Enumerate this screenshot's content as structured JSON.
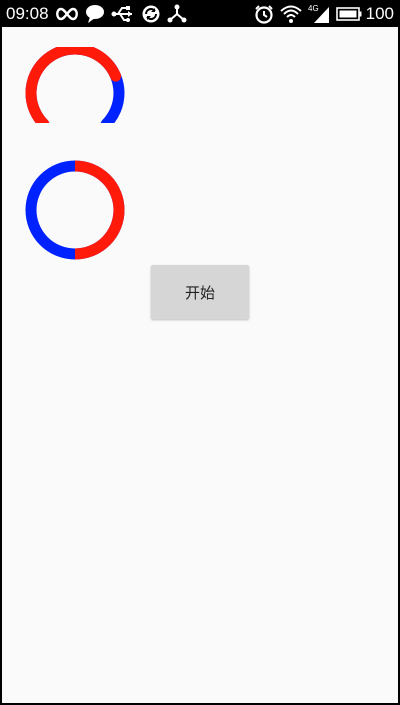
{
  "status_bar": {
    "time": "09:08",
    "battery_level": "100",
    "network_label": "4G",
    "left_icons": [
      "infinity-icon",
      "chat-bubble-icon",
      "usb-icon",
      "sync-icon",
      "share-icon"
    ],
    "right_icons": [
      "alarm-icon",
      "wifi-icon",
      "signal-icon",
      "battery-icon"
    ]
  },
  "colors": {
    "progress_color": "#ff1a0a",
    "track_color": "#0022ff",
    "screen_background": "#fafafa",
    "button_background": "#d6d6d6"
  },
  "progress_arc": {
    "progress_fraction": 0.75
  },
  "progress_ring": {
    "progress_fraction": 0.5
  },
  "start_button": {
    "label": "开始"
  }
}
